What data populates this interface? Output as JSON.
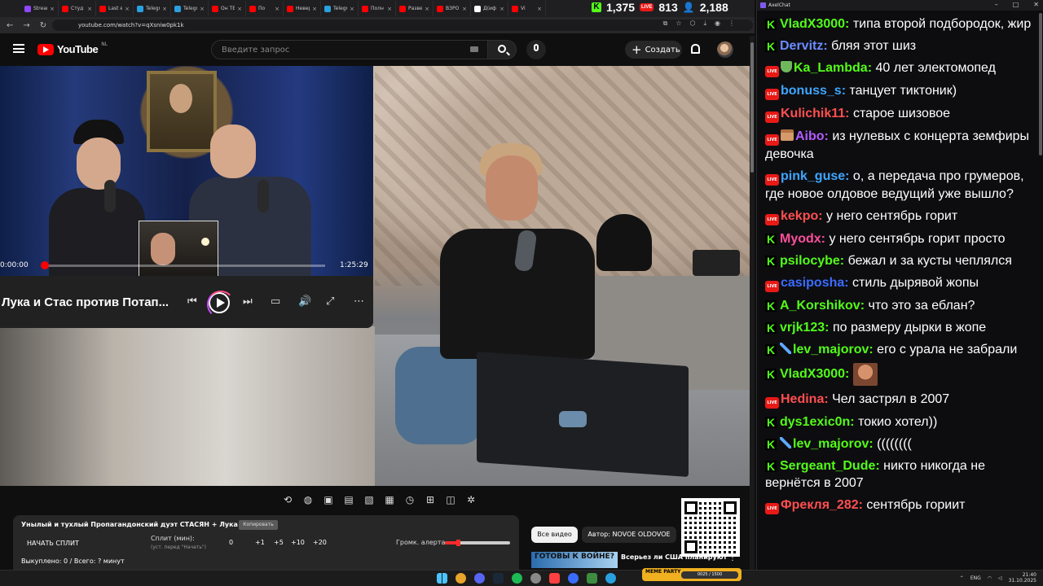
{
  "browser": {
    "tabs": [
      {
        "label": "Stream",
        "color": "#9146ff"
      },
      {
        "label": "Студ",
        "color": "#ff0000"
      },
      {
        "label": "Last e",
        "color": "#ff0000"
      },
      {
        "label": "Telegr",
        "color": "#2aa0e0"
      },
      {
        "label": "Telegr",
        "color": "#2aa0e0"
      },
      {
        "label": "Он ТЕ",
        "color": "#ff0000"
      },
      {
        "label": "По",
        "color": "#ff0000"
      },
      {
        "label": "Невер",
        "color": "#ff0000"
      },
      {
        "label": "Telegr",
        "color": "#2aa0e0"
      },
      {
        "label": "Полн",
        "color": "#ff0000"
      },
      {
        "label": "Разве",
        "color": "#ff0000"
      },
      {
        "label": "ВЗРО",
        "color": "#ff0000"
      },
      {
        "label": "Д(иф",
        "color": "#ffffff"
      },
      {
        "label": "Vi",
        "color": "#ff0000"
      }
    ],
    "url": "youtube.com/watch?v=qXsniw0pk1k"
  },
  "stream_stats": {
    "kick_count": "1,375",
    "live_badge": "LIVE",
    "live_count": "813",
    "viewers": "2,188"
  },
  "youtube": {
    "logo": "YouTube",
    "region": "NL",
    "search_placeholder": "Введите запрос",
    "create_label": "Создать"
  },
  "miniplayer": {
    "time_current": "0:00:00",
    "time_total": "1:25:29",
    "progress": 0.0,
    "title": "Лука и Стас против Потап..."
  },
  "extension": {
    "title": "Унылый и тухлый Пропагандонский дуэт СТАСЯН + Лука Ебков",
    "copy_label": "Копировать",
    "split_button": "НАЧАТЬ СПЛИТ",
    "split_label": "Сплит (мин):",
    "split_hint": "(уст. перед \"Начать\")",
    "split_value": "0",
    "increments": [
      "+1",
      "+5",
      "+10",
      "+20"
    ],
    "alert_label": "Громк. алерта:",
    "alert_level": 0.2,
    "status": "Выкуплено: 0 / Всего: ? минут"
  },
  "chips": {
    "all_videos": "Все видео",
    "author": "Автор: NOVOE OLDOVOE"
  },
  "recommendation": {
    "thumb_text": "ГОТОВЫ К ВОЙНЕ?",
    "title": "Всерьез ли США планируют"
  },
  "chat": {
    "window_title": "AxelChat",
    "messages": [
      {
        "platform": "kick",
        "badge": "",
        "user": "VladX3000:",
        "color": "#53fc18",
        "text": "типа второй подбородок, жир"
      },
      {
        "platform": "kick",
        "badge": "",
        "user": "Dervitz:",
        "color": "#6a8cff",
        "text": "бляя этот шиз"
      },
      {
        "platform": "live",
        "badge": "shield",
        "user": "Ka_Lambda:",
        "color": "#53fc18",
        "text": "40 лет электомопед"
      },
      {
        "platform": "live",
        "badge": "",
        "user": "bonuss_s:",
        "color": "#3ea6ff",
        "text": "танцует тиктоник)"
      },
      {
        "platform": "live",
        "badge": "",
        "user": "Kulichik11:",
        "color": "#ff4f4f",
        "text": "старое шизовое"
      },
      {
        "platform": "live",
        "badge": "gift",
        "user": "Aibo:",
        "color": "#b45bff",
        "text": "из нулевых с концерта земфиры девочка"
      },
      {
        "platform": "live",
        "badge": "",
        "user": "pink_guse:",
        "color": "#3ea6ff",
        "text": "о, а передача про грумеров, где новое олдовое ведущий уже вышло?"
      },
      {
        "platform": "live",
        "badge": "",
        "user": "kekpo:",
        "color": "#ff4f4f",
        "text": "у него сентябрь горит"
      },
      {
        "platform": "kick",
        "badge": "",
        "user": "Myodx:",
        "color": "#ff4f9a",
        "text": "у него сентябрь горит просто"
      },
      {
        "platform": "kick",
        "badge": "",
        "user": "psilocybe:",
        "color": "#53fc18",
        "text": "бежал и за кусты чеплялся"
      },
      {
        "platform": "live",
        "badge": "",
        "user": "casiposha:",
        "color": "#3a6cff",
        "text": "стиль дырявой жопы"
      },
      {
        "platform": "kick",
        "badge": "",
        "user": "A_Korshikov:",
        "color": "#53fc18",
        "text": "что это за еблан?"
      },
      {
        "platform": "kick",
        "badge": "",
        "user": "vrjk123:",
        "color": "#53fc18",
        "text": "по размеру дырки в жопе"
      },
      {
        "platform": "kick",
        "badge": "sword",
        "user": "lev_majorov:",
        "color": "#53fc18",
        "text": "его с урала не забрали"
      },
      {
        "platform": "kick",
        "badge": "",
        "user": "VladX3000:",
        "color": "#53fc18",
        "text": "",
        "emote": true
      },
      {
        "platform": "live",
        "badge": "",
        "user": "Hedina:",
        "color": "#ff4f4f",
        "text": "Чел застрял в 2007"
      },
      {
        "platform": "kick",
        "badge": "",
        "user": "dys1exic0n:",
        "color": "#53fc18",
        "text": "токио хотел))"
      },
      {
        "platform": "kick",
        "badge": "sword",
        "user": "lev_majorov:",
        "color": "#53fc18",
        "text": "(((((((("
      },
      {
        "platform": "kick",
        "badge": "",
        "user": "Sergeant_Dude:",
        "color": "#53fc18",
        "text": "никто никогда не вернётся в 2007"
      },
      {
        "platform": "live",
        "badge": "",
        "user": "Фрекля_282:",
        "color": "#ff4f4f",
        "text": "сентябрь гориит"
      }
    ]
  },
  "taskbar": {
    "lang": "ENG",
    "time": "21:40",
    "date": "31.10.2025"
  },
  "meme_widget": {
    "label": "MEME PARTY",
    "counter": "0025 / 1500"
  }
}
